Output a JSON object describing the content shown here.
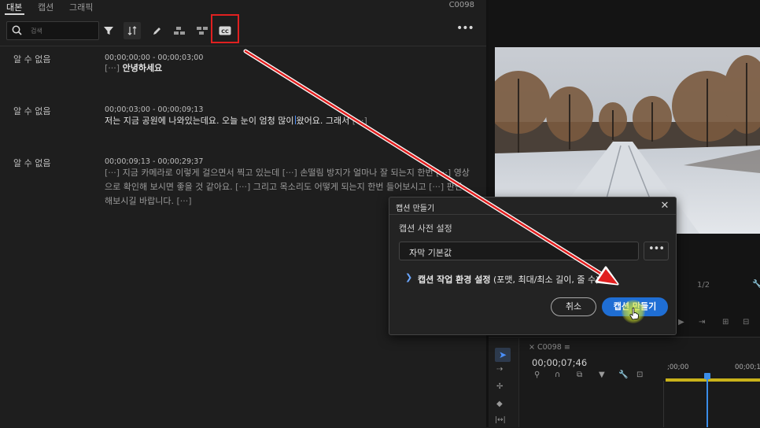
{
  "transcript_panel": {
    "tabs": [
      "대본",
      "캡션",
      "그래픽"
    ],
    "active_tab": 0,
    "sequence_name": "C0098",
    "search_placeholder": "검색",
    "entries": [
      {
        "speaker": "알 수 없음",
        "timecode": "00;00;00;00 - 00;00;03;00",
        "gap_marker": "[···]",
        "text": "안녕하세요"
      },
      {
        "speaker": "알 수 없음",
        "timecode": "00;00;03;00 - 00;00;09;13",
        "text_before_cursor": "저는 지금 공원에 나와있는데요. 오늘 눈이 엄청 많이",
        "text_after_cursor": "왔어요. 그래서",
        "gap_marker": "[···]"
      },
      {
        "speaker": "알 수 없음",
        "timecode": "00;00;09;13 - 00;00;29;37",
        "gap_marker": "[···]",
        "text_segments": [
          "지금 카메라로 이렇게 걸으면서 찍고 있는데",
          "손떨림 방지가 얼마나 잘 되는지 한번",
          "영상으로 확인해 보시면 좋을 것 같아요.",
          "그리고 목소리도 어떻게 되는지 한번 들어보시고",
          "판단해보시길 바랍니다."
        ]
      }
    ]
  },
  "dialog": {
    "title": "캡션 만들기",
    "preset_label": "캡션 사전 설정",
    "preset_value": "자막 기본값",
    "settings_label": "캡션 작업 환경 설정",
    "settings_detail": "(포맷, 최대/최소 길이, 줄 수)",
    "cancel_label": "취소",
    "create_label": "캡션 만들기"
  },
  "timeline": {
    "tab_label": "C0098",
    "timecode": "00;00;07;46",
    "ruler_start": ";00;00",
    "ruler_next": "00;00;1"
  },
  "program_monitor": {
    "resolution": "1/2"
  },
  "colors": {
    "annotation_red": "#e02020",
    "primary_button": "#1f6ed4",
    "playhead": "#3a8de8",
    "work_area": "#c9b21a"
  }
}
